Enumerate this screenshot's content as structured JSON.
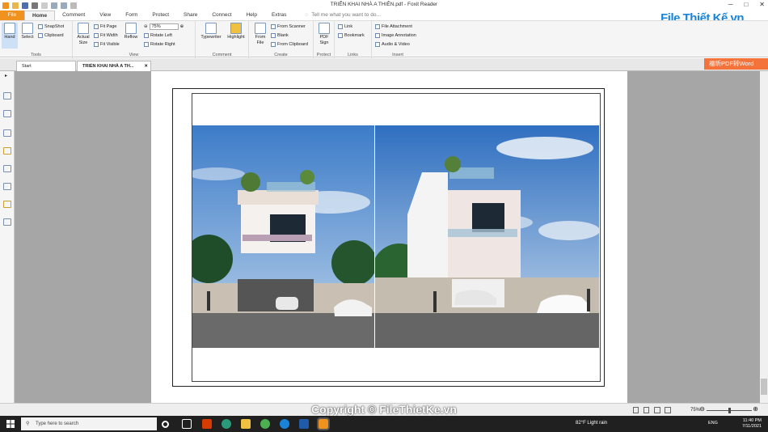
{
  "window": {
    "title": "TRIỂN KHAI NHÀ A THIÊN.pdf - Foxit Reader"
  },
  "menu": {
    "items": [
      "File",
      "Home",
      "Comment",
      "View",
      "Form",
      "Protect",
      "Share",
      "Connect",
      "Help",
      "Extras"
    ],
    "tell_me": "Tell me what you want to do..."
  },
  "ribbon": {
    "tools": {
      "hand": "Hand",
      "select": "Select",
      "snapshot": "SnapShot",
      "clipboard": "Clipboard",
      "group": "Tools"
    },
    "view": {
      "actual_size": "Actual Size",
      "fit_page": "Fit Page",
      "fit_width": "Fit Width",
      "fit_visible": "Fit Visible",
      "reflow": "Reflow",
      "zoom_value": "75%",
      "rotate_left": "Rotate Left",
      "rotate_right": "Rotate Right",
      "group": "View"
    },
    "comment": {
      "typewriter": "Typewriter",
      "highlight": "Highlight",
      "group": "Comment"
    },
    "create": {
      "from_file": "From File",
      "from_scanner": "From Scanner",
      "blank": "Blank",
      "from_clipboard": "From Clipboard",
      "group": "Create"
    },
    "protect": {
      "pdf_sign": "PDF Sign",
      "group": "Protect"
    },
    "links": {
      "link": "Link",
      "bookmark": "Bookmark",
      "group": "Links"
    },
    "insert": {
      "file_attachment": "File Attachment",
      "image_annotation": "Image Annotation",
      "audio_video": "Audio & Video",
      "group": "Insert"
    }
  },
  "brand": {
    "logo_text": "File Thiết Kế.vn",
    "accent": "#1a84d8"
  },
  "tabs": [
    {
      "label": "Start"
    },
    {
      "label": "TRIỂN KHAI NHÀ A TH..."
    }
  ],
  "pdf_to_word": "福昕PDF转Word",
  "status": {
    "zoom": "75%"
  },
  "watermark": "Copyright © FileThietKe.vn",
  "taskbar": {
    "search_placeholder": "Type here to search",
    "weather": "82°F  Light rain",
    "lang": "ENG",
    "time": "11:40 PM",
    "date": "7/11/2021"
  }
}
